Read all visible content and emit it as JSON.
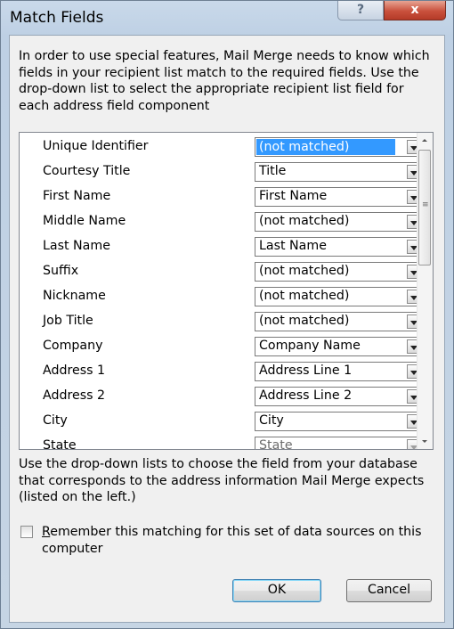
{
  "window": {
    "title": "Match Fields",
    "help_glyph": "?",
    "close_glyph": "x"
  },
  "intro_text": "In order to use special features, Mail Merge needs to know which fields in your recipient list match to the required fields. Use the drop-down list to select the appropriate recipient list field for each address field component",
  "fields": [
    {
      "label": "Unique Identifier",
      "value": "(not matched)"
    },
    {
      "label": "Courtesy Title",
      "value": "Title"
    },
    {
      "label": "First Name",
      "value": "First Name"
    },
    {
      "label": "Middle Name",
      "value": "(not matched)"
    },
    {
      "label": "Last Name",
      "value": "Last Name"
    },
    {
      "label": "Suffix",
      "value": "(not matched)"
    },
    {
      "label": "Nickname",
      "value": "(not matched)"
    },
    {
      "label": "Job Title",
      "value": "(not matched)"
    },
    {
      "label": "Company",
      "value": "Company Name"
    },
    {
      "label": "Address 1",
      "value": "Address Line 1"
    },
    {
      "label": "Address 2",
      "value": "Address Line 2"
    },
    {
      "label": "City",
      "value": "City"
    },
    {
      "label": "State",
      "value": "State"
    }
  ],
  "bottom_text": "Use the drop-down lists to choose the field from your database that corresponds to the address information Mail Merge expects (listed on the left.)",
  "remember": {
    "label_underlined": "R",
    "label_rest": "emember this matching for this set of data sources on this computer",
    "checked": false
  },
  "buttons": {
    "ok": "OK",
    "cancel": "Cancel"
  },
  "colors": {
    "selection": "#3399ff",
    "close_button": "#c9503c"
  }
}
